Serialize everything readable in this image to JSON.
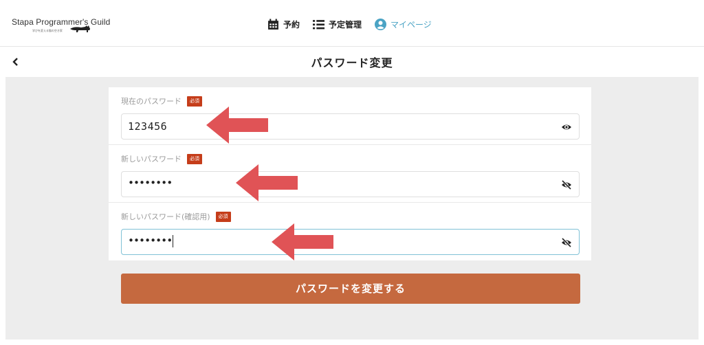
{
  "brand": {
    "name": "Stapa Programmer's Guild",
    "tagline": "学びを変える猫の空き家"
  },
  "nav": {
    "items": [
      {
        "label": "予約",
        "icon": "calendar-icon"
      },
      {
        "label": "予定管理",
        "icon": "list-icon"
      },
      {
        "label": "マイページ",
        "icon": "user-circle-icon",
        "active": true
      }
    ]
  },
  "page": {
    "title": "パスワード変更",
    "back_icon": "chevron-left-icon"
  },
  "form": {
    "required_badge": "必須",
    "fields": [
      {
        "label": "現在のパスワード",
        "value": "123456",
        "visibility_icon": "eye-icon"
      },
      {
        "label": "新しいパスワード",
        "value": "••••••••",
        "visibility_icon": "eye-slash-icon"
      },
      {
        "label": "新しいパスワード(確認用)",
        "value": "••••••••",
        "visibility_icon": "eye-slash-icon"
      }
    ],
    "submit_label": "パスワードを変更する"
  },
  "colors": {
    "accent": "#c5693f",
    "required": "#c53d1a",
    "annotation_arrow": "#e05356",
    "nav_active": "#4aa3c4",
    "background": "#ededed"
  }
}
